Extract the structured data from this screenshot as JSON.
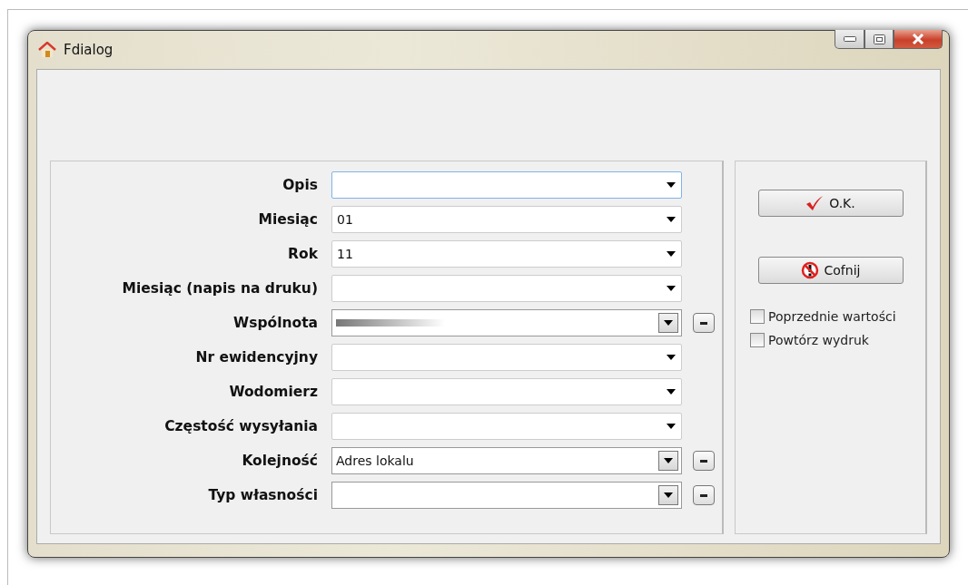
{
  "window": {
    "title": "Fdialog"
  },
  "fields": [
    {
      "label": "Opis",
      "kind": "combo",
      "focused": true
    },
    {
      "label": "Miesiąc",
      "kind": "combo",
      "value": "01",
      "focused": false
    },
    {
      "label": "Rok",
      "kind": "combo",
      "value": "11",
      "focused": false
    },
    {
      "label": "Miesiąc (napis na druku)",
      "kind": "combo",
      "focused": false
    },
    {
      "label": "Wspólnota",
      "kind": "lookup",
      "redacted": true,
      "focused": false
    },
    {
      "label": "Nr ewidencyjny",
      "kind": "combo",
      "focused": false
    },
    {
      "label": "Wodomierz",
      "kind": "combo",
      "focused": false
    },
    {
      "label": "Częstość wysyłania",
      "kind": "combo",
      "focused": false
    },
    {
      "label": "Kolejność",
      "kind": "lookup",
      "value": "Adres lokalu",
      "focused": false
    },
    {
      "label": "Typ własności",
      "kind": "lookup",
      "focused": false
    }
  ],
  "buttons": [
    {
      "label": "O.K.",
      "kind": "ok"
    },
    {
      "label": "Cofnij",
      "kind": "cancel"
    }
  ],
  "options": [
    {
      "label": "Poprzednie wartości",
      "checked": false
    },
    {
      "label": "Powtórz wydruk",
      "checked": false
    }
  ]
}
